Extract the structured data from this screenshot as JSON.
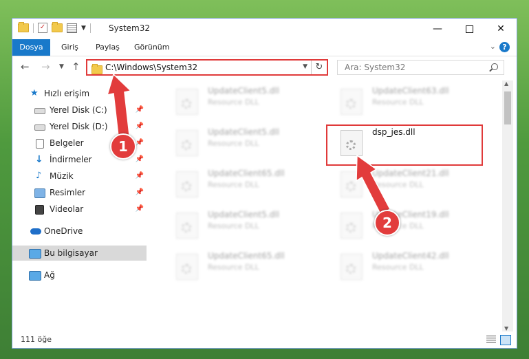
{
  "window": {
    "title": "System32",
    "controls": {
      "minimize": "—",
      "close": "✕"
    }
  },
  "ribbon": {
    "tabs": [
      "Dosya",
      "Giriş",
      "Paylaş",
      "Görünüm"
    ],
    "collapse_icon": "chevron-down-icon",
    "help": "?"
  },
  "nav": {
    "address": "C:\\Windows\\System32",
    "search_placeholder": "Ara: System32"
  },
  "sidebar": {
    "items": [
      {
        "label": "Hızlı erişim",
        "icon": "star-icon"
      },
      {
        "label": "Yerel Disk (C:)",
        "icon": "drive-icon",
        "pinned": true
      },
      {
        "label": "Yerel Disk (D:)",
        "icon": "drive-icon",
        "pinned": true
      },
      {
        "label": "Belgeler",
        "icon": "documents-icon",
        "pinned": true
      },
      {
        "label": "İndirmeler",
        "icon": "download-icon",
        "pinned": true
      },
      {
        "label": "Müzik",
        "icon": "music-icon",
        "pinned": true
      },
      {
        "label": "Resimler",
        "icon": "pictures-icon",
        "pinned": true
      },
      {
        "label": "Videolar",
        "icon": "video-icon",
        "pinned": true
      },
      {
        "label": "OneDrive",
        "icon": "cloud-icon"
      },
      {
        "label": "Bu bilgisayar",
        "icon": "computer-icon",
        "selected": true
      },
      {
        "label": "Ağ",
        "icon": "network-icon"
      }
    ]
  },
  "files": [
    {
      "name": "UpdateClient5.dll",
      "desc": "Resource DLL"
    },
    {
      "name": "UpdateClient63.dll",
      "desc": "Resource DLL"
    },
    {
      "name": "UpdateClient5.dll",
      "desc": "Resource DLL"
    },
    {
      "name": "dsp_jes.dll",
      "desc": ""
    },
    {
      "name": "UpdateClient65.dll",
      "desc": "Resource DLL"
    },
    {
      "name": "UpdateClient21.dll",
      "desc": "Resource DLL"
    },
    {
      "name": "UpdateClient5.dll",
      "desc": "Resource DLL"
    },
    {
      "name": "UpdateClient19.dll",
      "desc": "Resource DLL"
    },
    {
      "name": "UpdateClient65.dll",
      "desc": "Resource DLL"
    },
    {
      "name": "UpdateClient42.dll",
      "desc": "Resource DLL"
    }
  ],
  "status": {
    "item_count": "111 öğe"
  },
  "annotations": {
    "step1": "1",
    "step2": "2",
    "color": "#e23c3c"
  }
}
